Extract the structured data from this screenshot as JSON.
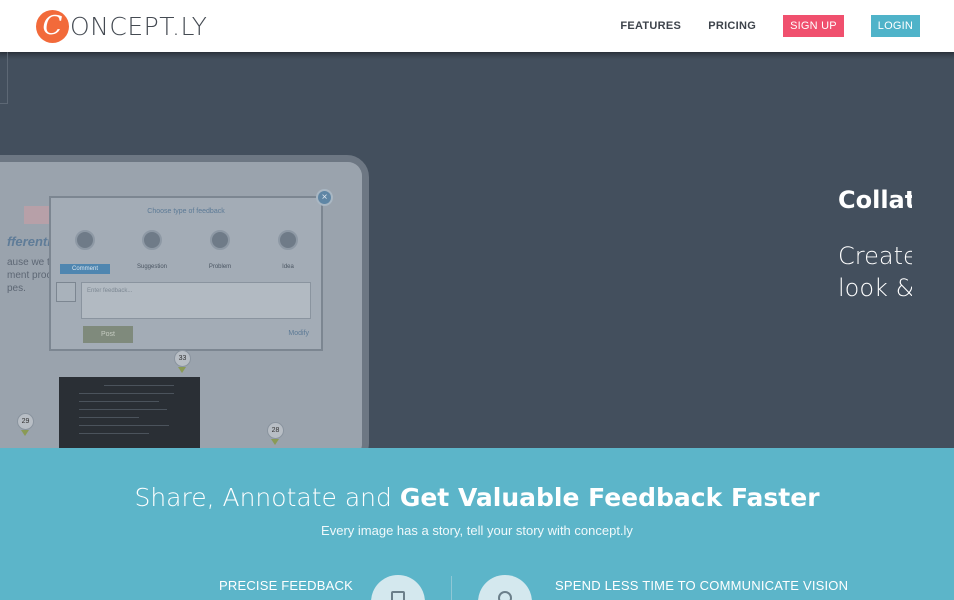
{
  "header": {
    "logo_mark": "C",
    "logo_text": "ONCEPT.LY",
    "nav": {
      "features": "FEATURES",
      "pricing": "PRICING",
      "signup": "SIGN UP",
      "login": "LOGIN"
    }
  },
  "hero": {
    "heading": "Collat",
    "sub_line1": "Create",
    "sub_line2": "look &",
    "mockup": {
      "screen_title": "fferenti",
      "screen_text_1": "ause we t",
      "screen_text_2": "ment proc",
      "screen_text_3": "pes.",
      "dialog_title": "Choose type of feedback",
      "options": [
        "Comment",
        "Suggestion",
        "Problem",
        "Idea"
      ],
      "input_placeholder": "Enter feedback...",
      "post_label": "Post",
      "modify_label": "Modify",
      "pins": [
        "33",
        "29",
        "28"
      ]
    }
  },
  "band": {
    "title_plain": "Share, Annotate and ",
    "title_bold": "Get Valuable Feedback Faster",
    "subtitle": "Every image has a story, tell your story with concept.ly",
    "feature_left": "PRECISE FEEDBACK",
    "feature_right": "SPEND LESS TIME TO COMMUNICATE VISION"
  },
  "colors": {
    "brand_orange": "#f26a3a",
    "signup_pink": "#f0506e",
    "login_blue": "#4fb3c9",
    "hero_bg": "#434f5d",
    "band_bg": "#5cb5c9"
  }
}
